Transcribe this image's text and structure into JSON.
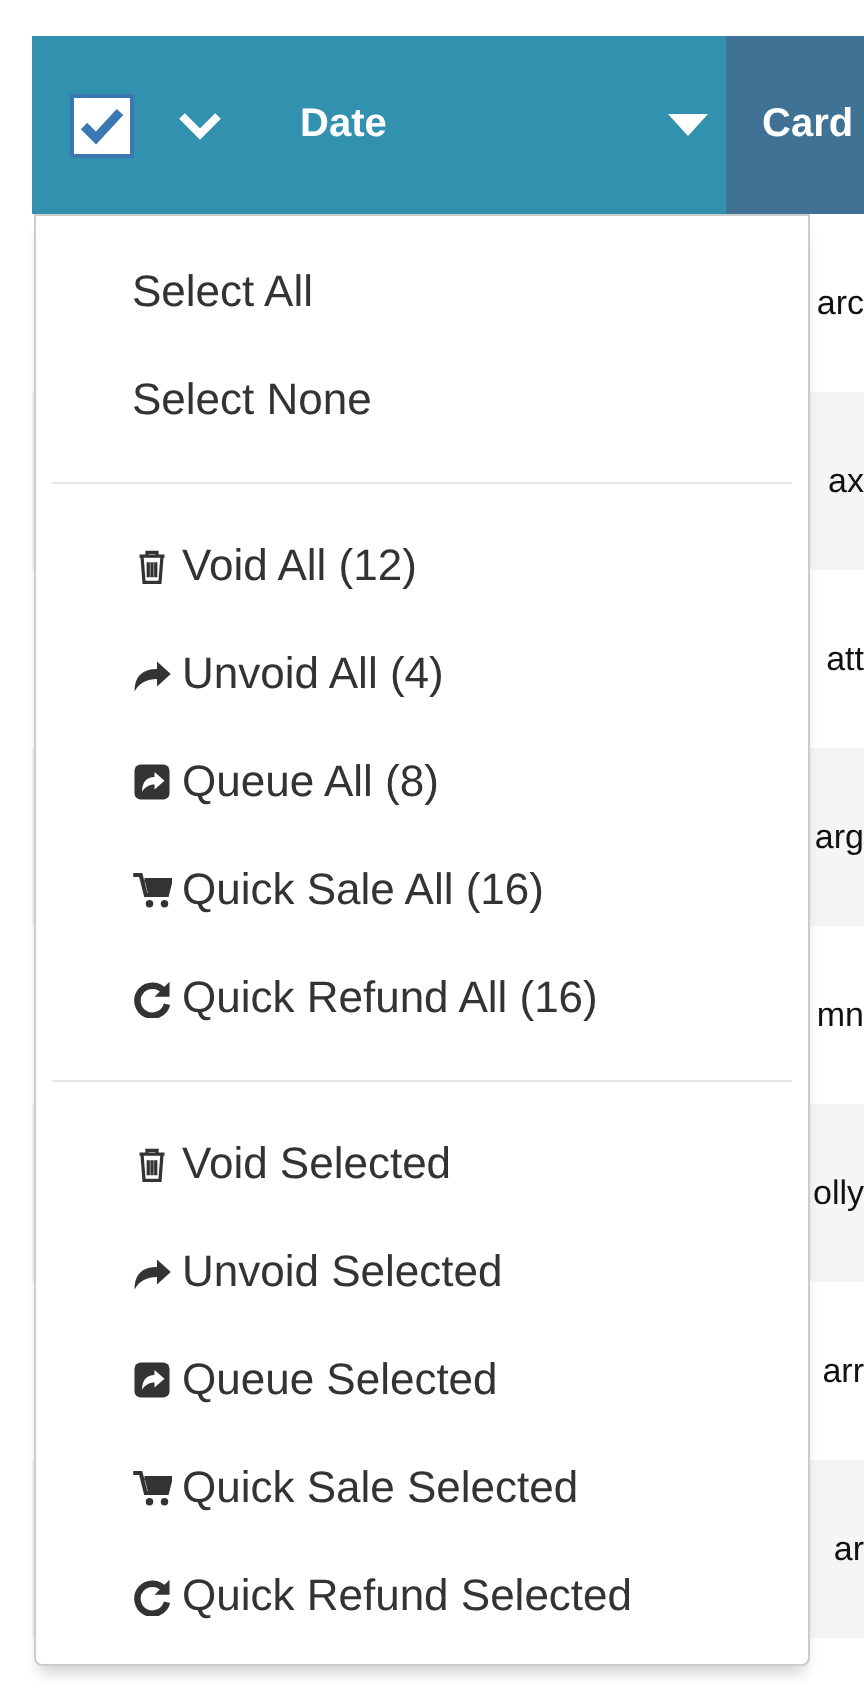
{
  "header": {
    "select_all_checkbox": {
      "checked": true
    },
    "columns": [
      {
        "label": "Date",
        "selected": false
      },
      {
        "label": "Card",
        "selected": true
      }
    ]
  },
  "rows": [
    {
      "card": "arc"
    },
    {
      "card": "ax"
    },
    {
      "card": "att"
    },
    {
      "card": "arg"
    },
    {
      "card": "mn"
    },
    {
      "card": "olly"
    },
    {
      "card": "arr"
    },
    {
      "card": "ar"
    }
  ],
  "menu": {
    "sections": [
      {
        "items": [
          {
            "label": "Select All",
            "kind": "plain"
          },
          {
            "label": "Select None",
            "kind": "plain"
          }
        ]
      },
      {
        "items": [
          {
            "label": "Void All (12)",
            "kind": "trash"
          },
          {
            "label": "Unvoid All (4)",
            "kind": "arrow"
          },
          {
            "label": "Queue All (8)",
            "kind": "share"
          },
          {
            "label": "Quick Sale All (16)",
            "kind": "cart"
          },
          {
            "label": "Quick Refund All (16)",
            "kind": "redo"
          }
        ]
      },
      {
        "items": [
          {
            "label": "Void Selected",
            "kind": "trash"
          },
          {
            "label": "Unvoid Selected",
            "kind": "arrow"
          },
          {
            "label": "Queue Selected",
            "kind": "share"
          },
          {
            "label": "Quick Sale Selected",
            "kind": "cart"
          },
          {
            "label": "Quick Refund Selected",
            "kind": "redo"
          }
        ]
      }
    ]
  }
}
